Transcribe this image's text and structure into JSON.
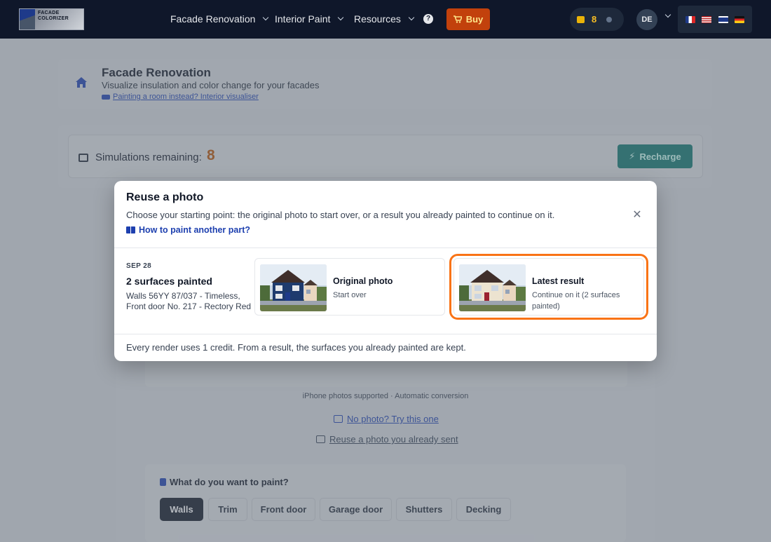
{
  "topbar": {
    "logo_text": "FACADE COLORIZER",
    "nav": [
      {
        "label": "Facade Renovation"
      },
      {
        "label": "Interior Paint"
      },
      {
        "label": "Resources"
      }
    ],
    "buy_label": "Buy",
    "credits": "8",
    "language": "DE",
    "flags": [
      "fr",
      "us",
      "gb",
      "de"
    ]
  },
  "page_header": {
    "title": "Facade Renovation",
    "subtitle": "Visualize insulation and color change for your facades",
    "link": "Painting a room instead? Interior visualiser"
  },
  "simulations": {
    "label": "Simulations remaining:",
    "count": "8",
    "recharge_label": "Recharge"
  },
  "upload": {
    "note": "iPhone photos supported · Automatic conversion",
    "try_link": "No photo? Try this one",
    "reuse_link": "Reuse a photo you already sent"
  },
  "paint_panel": {
    "title": "What do you want to paint?",
    "tabs": [
      "Walls",
      "Trim",
      "Front door",
      "Garage door",
      "Shutters",
      "Decking"
    ],
    "active_tab": "Walls"
  },
  "modal": {
    "title": "Reuse a photo",
    "description": "Choose your starting point: the original photo to start over, or a result you already painted to continue on it.",
    "howto": "How to paint another part?",
    "history": {
      "date": "SEP 28",
      "title": "2 surfaces painted",
      "details": "Walls 56YY 87/037 - Timeless, Front door No. 217 - Rectory Red"
    },
    "options": [
      {
        "name": "Original photo",
        "sub": "Start over"
      },
      {
        "name": "Latest result",
        "sub": "Continue on it (2 surfaces painted)"
      }
    ],
    "footer": "Every render uses 1 credit. From a result, the surfaces you already painted are kept.",
    "colors": {
      "accent": "#1e40af",
      "selected_outline": "#f97316",
      "wall_original": "#1f3b6e",
      "wall_painted": "#ece3d0",
      "door_red": "#9b2230"
    }
  }
}
